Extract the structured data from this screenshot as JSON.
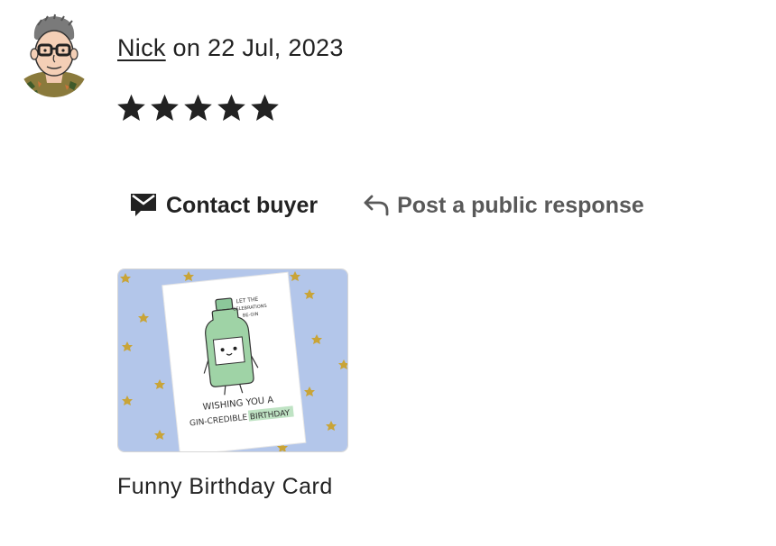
{
  "review": {
    "reviewer_name": "Nick",
    "date_text": "on 22 Jul, 2023",
    "rating": 5,
    "rating_max": 5
  },
  "actions": {
    "contact_label": "Contact buyer",
    "respond_label": "Post a public response"
  },
  "product": {
    "title": "Funny Birthday Card",
    "image_text": {
      "small_line1": "LET THE",
      "small_line2": "CELEBRATIONS",
      "small_line3": "BE-GIN",
      "line1": "WISHING YOU A",
      "line2": "GIN-CREDIBLE BIRTHDAY"
    }
  },
  "colors": {
    "text": "#222222",
    "muted": "#595959",
    "card_background": "#b3c6ea",
    "gin_green": "#9fd3a6",
    "star_gold": "#c9a437"
  },
  "icons": {
    "contact": "envelope-icon",
    "respond": "reply-arrow-icon",
    "star": "star-icon"
  }
}
